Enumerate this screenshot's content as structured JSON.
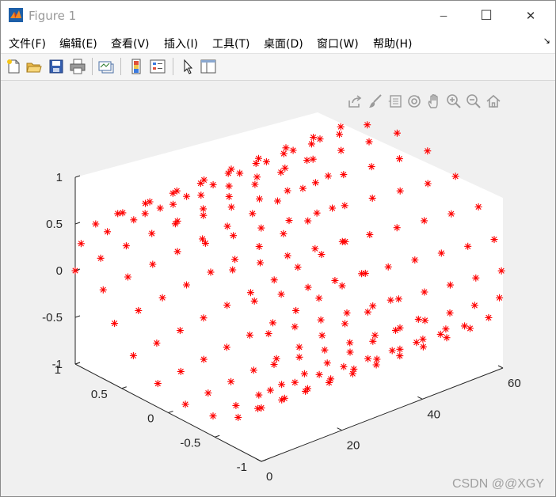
{
  "window": {
    "title": "Figure 1",
    "minimize_glyph": "─",
    "maximize_glyph": "☐",
    "close_glyph": "✕"
  },
  "menu": {
    "items": [
      "文件(F)",
      "编辑(E)",
      "查看(V)",
      "插入(I)",
      "工具(T)",
      "桌面(D)",
      "窗口(W)",
      "帮助(H)"
    ],
    "overflow_glyph": "↘"
  },
  "toolbar": {
    "icons": [
      "new-figure-icon",
      "open-file-icon",
      "save-icon",
      "print-icon",
      "link-plot-icon",
      "insert-colorbar-icon",
      "insert-legend-icon",
      "edit-plot-arrow-icon",
      "property-inspector-icon"
    ]
  },
  "axes_toolbar": {
    "icons": [
      "export-icon",
      "brush-icon",
      "data-tips-icon",
      "rotate-3d-icon",
      "pan-hand-icon",
      "zoom-in-icon",
      "zoom-out-icon",
      "home-restore-icon"
    ]
  },
  "chart_data": {
    "type": "scatter3d",
    "title": "",
    "xlabel": "",
    "ylabel": "",
    "zlabel": "",
    "marker": "*",
    "color": "#ff0000",
    "x_axis": {
      "range": [
        0,
        60
      ],
      "ticks": [
        "0",
        "20",
        "40",
        "60"
      ]
    },
    "y_axis": {
      "range": [
        -1,
        1
      ],
      "ticks": [
        "-1",
        "-0.5",
        "0",
        "0.5",
        "1"
      ]
    },
    "z_axis": {
      "range": [
        -1,
        1
      ],
      "ticks": [
        "-1",
        "-0.5",
        "0",
        "0.5",
        "1"
      ]
    },
    "series": [
      {
        "description_of_curve": "helix",
        "x_start": 0,
        "x_end": 62.8,
        "points": 200,
        "y": "cos(t)",
        "z": "sin(t)",
        "x": "t"
      }
    ],
    "grid": false,
    "view": {
      "azimuth": -37.5,
      "elevation": 30
    }
  },
  "watermark": "CSDN @@XGY"
}
